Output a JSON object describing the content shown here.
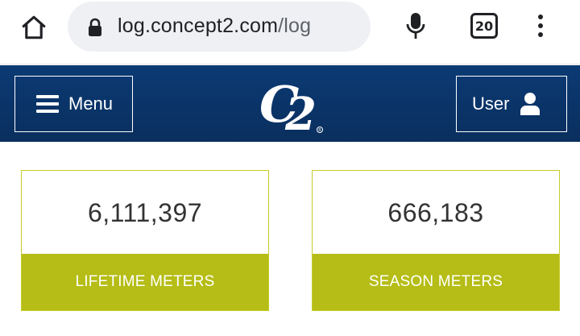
{
  "browser": {
    "url_host": "log.concept2.com",
    "url_path": "/log",
    "tab_count": "20",
    "icons": {
      "home": "home-icon",
      "lock": "lock-icon",
      "mic": "microphone-icon",
      "tabs": "tab-switcher-icon",
      "more": "more-vert-icon"
    }
  },
  "header": {
    "menu_label": "Menu",
    "user_label": "User",
    "logo_text": "C2",
    "background_color": "#0b3a74"
  },
  "stats": [
    {
      "value": "6,111,397",
      "label": "LIFETIME METERS"
    },
    {
      "value": "666,183",
      "label": "SEASON METERS"
    }
  ],
  "colors": {
    "accent": "#b5bd16",
    "header_blue": "#0b3a74"
  }
}
